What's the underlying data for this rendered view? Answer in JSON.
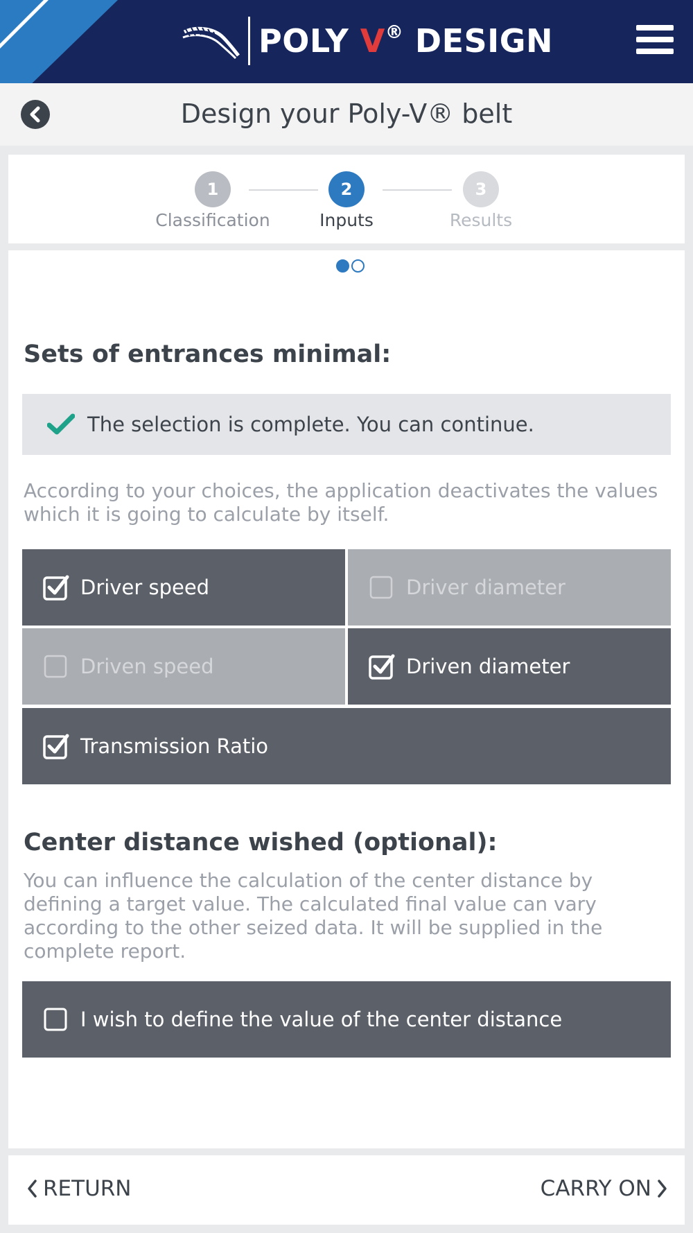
{
  "header": {
    "brand_prefix": "POLY ",
    "brand_v": "V",
    "brand_reg": "®",
    "brand_suffix": " DESIGN",
    "logo_icon": "belt-logo-icon",
    "menu_icon": "hamburger-menu-icon",
    "colors": {
      "background": "#16265c",
      "accent": "#2a7bc2",
      "brand_v": "#e23b3b"
    }
  },
  "subheader": {
    "title": "Design your Poly-V® belt",
    "back_icon": "chevron-left-circle-icon"
  },
  "stepper": {
    "steps": [
      {
        "number": "1",
        "label": "Classification",
        "state": "done"
      },
      {
        "number": "2",
        "label": "Inputs",
        "state": "active"
      },
      {
        "number": "3",
        "label": "Results",
        "state": "pending"
      }
    ]
  },
  "pager": {
    "pages": 2,
    "current": 1
  },
  "entrances": {
    "title": "Sets of entrances minimal:",
    "notice": "The selection is complete. You can continue.",
    "notice_icon": "checkmark-icon",
    "help": "According to your choices, the application deactivates the values which it is going to calculate by itself.",
    "options": [
      {
        "label": "Driver speed",
        "checked": true,
        "enabled": true
      },
      {
        "label": "Driver diameter",
        "checked": false,
        "enabled": false
      },
      {
        "label": "Driven speed",
        "checked": false,
        "enabled": false
      },
      {
        "label": "Driven diameter",
        "checked": true,
        "enabled": true
      },
      {
        "label": "Transmission Ratio",
        "checked": true,
        "enabled": true
      }
    ]
  },
  "center_distance": {
    "title": "Center distance wished (optional):",
    "help": "You can influence the calculation of the center distance by defining a target value. The calculated final value can vary according to the other seized data. It will be supplied in the complete report.",
    "option": {
      "label": "I wish to define the value of the center distance",
      "checked": false,
      "enabled": true
    }
  },
  "footer": {
    "return_label": "RETURN",
    "carry_on_label": "CARRY ON"
  }
}
